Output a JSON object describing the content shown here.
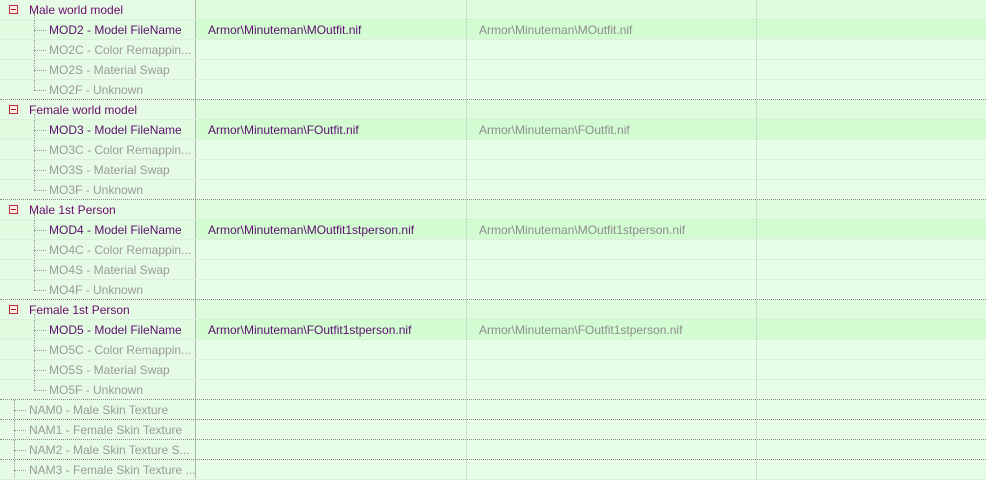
{
  "tree": {
    "groups": [
      {
        "label": "Male world model",
        "children": [
          {
            "label": "MOD2 - Model FileName",
            "value": "Armor\\Minuteman\\MOutfit.nif",
            "value2": "Armor\\Minuteman\\MOutfit.nif"
          },
          {
            "label": "MO2C - Color Remappin...",
            "value": "",
            "value2": ""
          },
          {
            "label": "MO2S - Material Swap",
            "value": "",
            "value2": ""
          },
          {
            "label": "MO2F - Unknown",
            "value": "",
            "value2": ""
          }
        ]
      },
      {
        "label": "Female world model",
        "children": [
          {
            "label": "MOD3 - Model FileName",
            "value": "Armor\\Minuteman\\FOutfit.nif",
            "value2": "Armor\\Minuteman\\FOutfit.nif"
          },
          {
            "label": "MO3C - Color Remappin...",
            "value": "",
            "value2": ""
          },
          {
            "label": "MO3S - Material Swap",
            "value": "",
            "value2": ""
          },
          {
            "label": "MO3F - Unknown",
            "value": "",
            "value2": ""
          }
        ]
      },
      {
        "label": "Male 1st Person",
        "children": [
          {
            "label": "MOD4 - Model FileName",
            "value": "Armor\\Minuteman\\MOutfit1stperson.nif",
            "value2": "Armor\\Minuteman\\MOutfit1stperson.nif"
          },
          {
            "label": "MO4C - Color Remappin...",
            "value": "",
            "value2": ""
          },
          {
            "label": "MO4S - Material Swap",
            "value": "",
            "value2": ""
          },
          {
            "label": "MO4F - Unknown",
            "value": "",
            "value2": ""
          }
        ]
      },
      {
        "label": "Female 1st Person",
        "children": [
          {
            "label": "MOD5 - Model FileName",
            "value": "Armor\\Minuteman\\FOutfit1stperson.nif",
            "value2": "Armor\\Minuteman\\FOutfit1stperson.nif"
          },
          {
            "label": "MO5C - Color Remappin...",
            "value": "",
            "value2": ""
          },
          {
            "label": "MO5S - Material Swap",
            "value": "",
            "value2": ""
          },
          {
            "label": "MO5F - Unknown",
            "value": "",
            "value2": ""
          }
        ]
      }
    ],
    "leaves": [
      {
        "label": "NAM0 - Male Skin Texture"
      },
      {
        "label": "NAM1 - Female Skin Texture"
      },
      {
        "label": "NAM2 - Male Skin Texture S..."
      },
      {
        "label": "NAM3 - Female Skin Texture ..."
      }
    ]
  },
  "colors": {
    "background": "#e8fde8",
    "highlight_row": "#d3fcd3",
    "group_text": "#6a0a6a",
    "active_text": "#5c0f6e",
    "dim_text": "#9a9a9a",
    "expander_border": "#c03030"
  },
  "icons": {
    "expander": "collapse-minus-icon"
  }
}
